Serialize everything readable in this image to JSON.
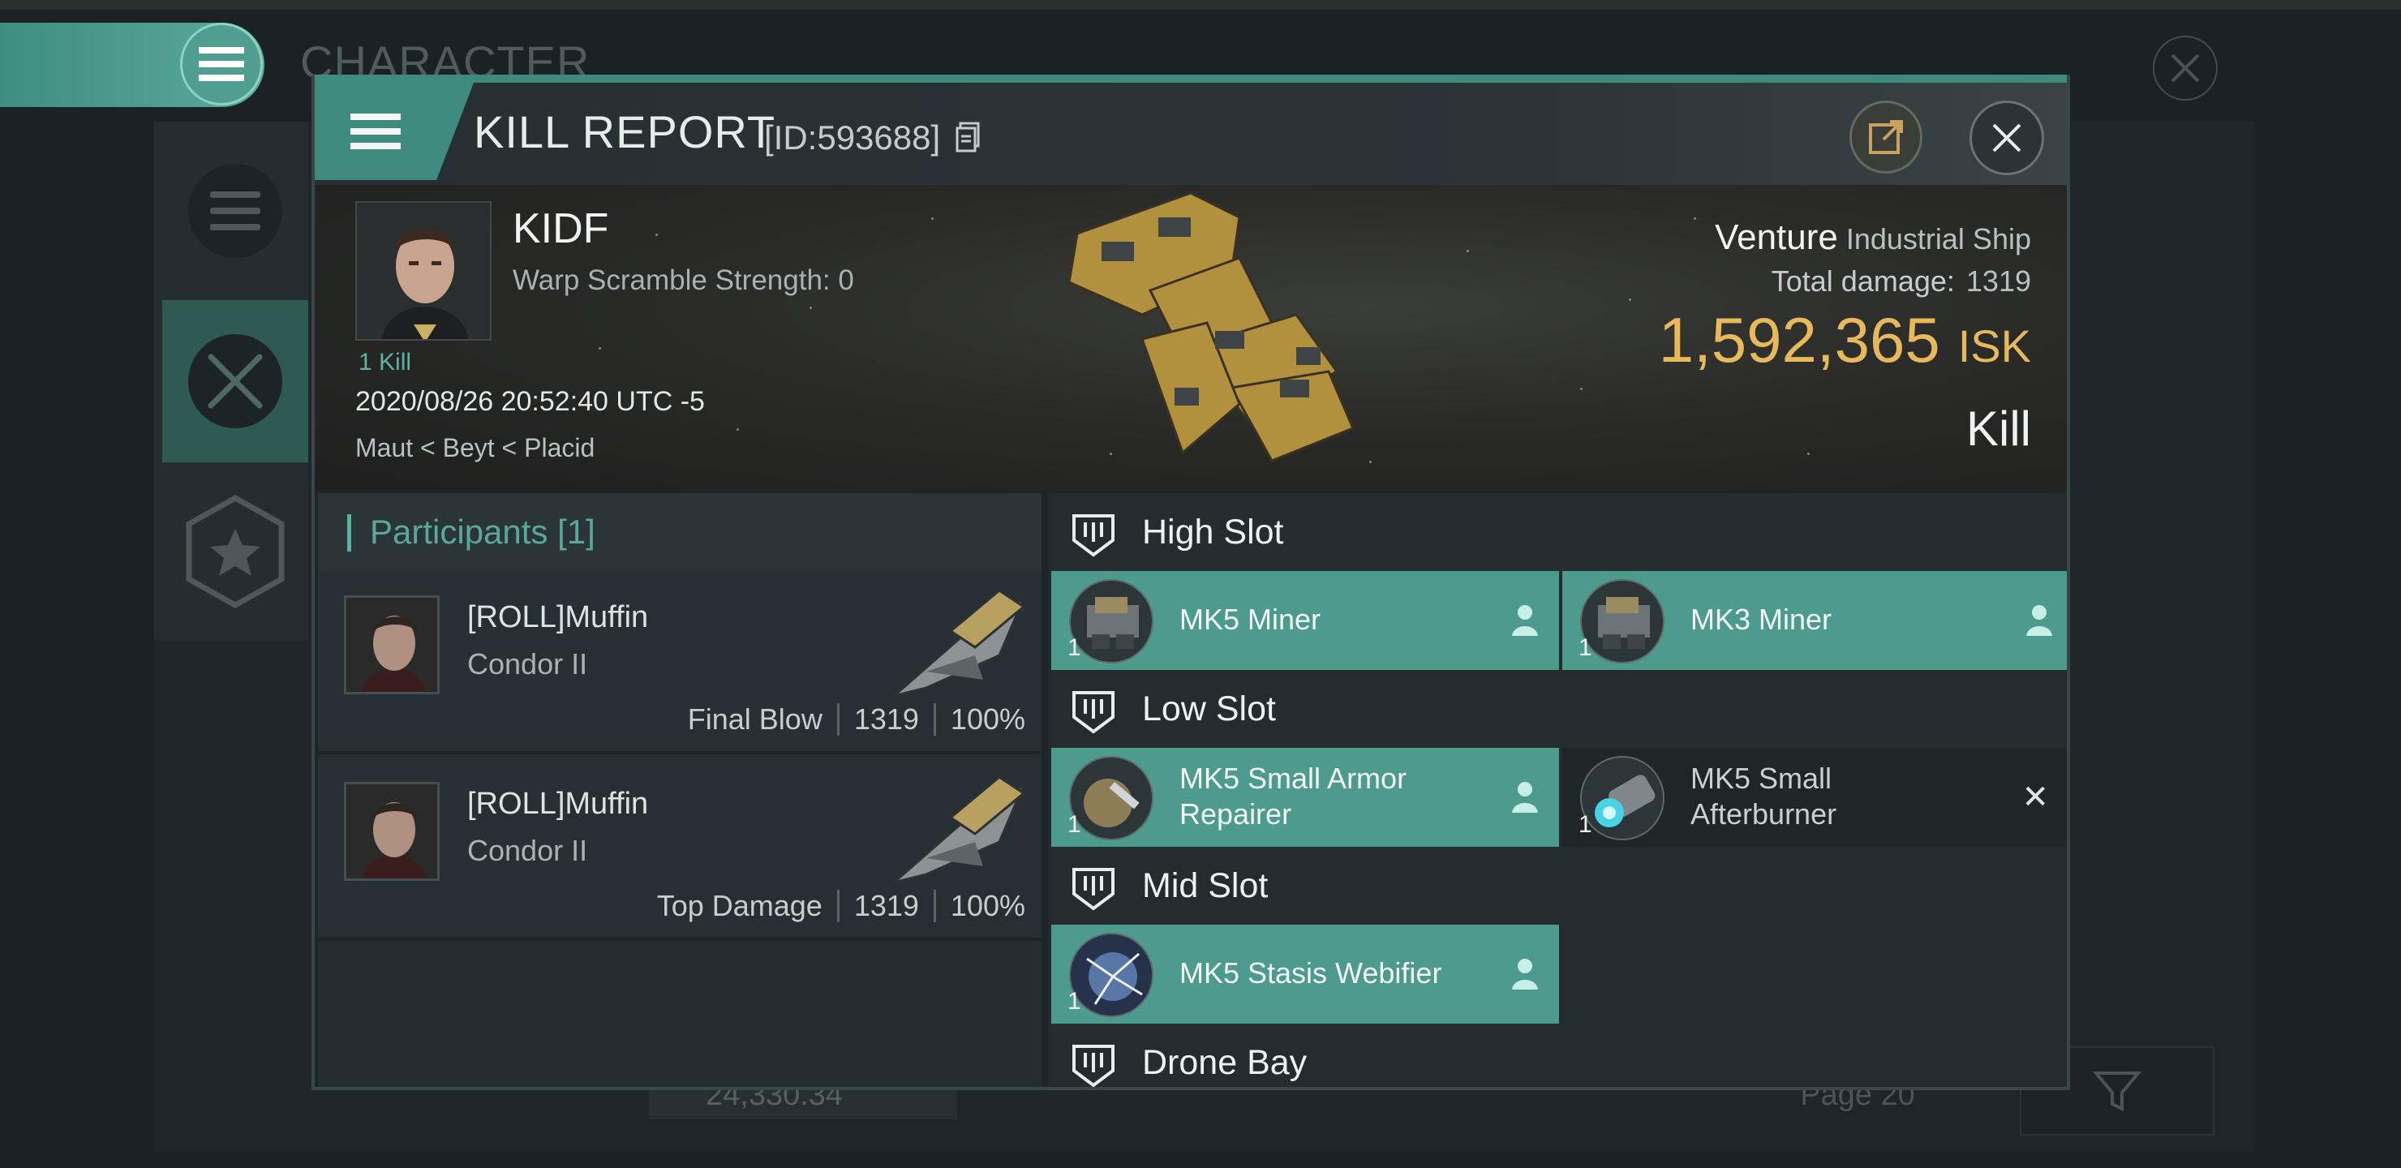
{
  "background": {
    "title": "CHARACTER",
    "bottom_value": "24,330.34",
    "page_label": "Page 20"
  },
  "dialog": {
    "title": "KILL REPORT",
    "report_id": "[ID:593688]"
  },
  "victim": {
    "name": "KIDF",
    "warp_scramble": "Warp Scramble Strength: 0",
    "kills_link": "1 Kill",
    "timestamp": "2020/08/26 20:52:40 UTC -5",
    "location": "Maut < Beyt < Placid"
  },
  "ship": {
    "name": "Venture",
    "class": "Industrial Ship",
    "total_damage_label": "Total damage:",
    "total_damage": "1319",
    "isk_value": "1,592,365",
    "isk_unit": "ISK",
    "result": "Kill"
  },
  "participants": {
    "header": "Participants [1]",
    "rows": [
      {
        "name": "[ROLL]Muffin",
        "ship": "Condor II",
        "role": "Final Blow",
        "damage": "1319",
        "percent": "100%"
      },
      {
        "name": "[ROLL]Muffin",
        "ship": "Condor II",
        "role": "Top Damage",
        "damage": "1319",
        "percent": "100%"
      }
    ]
  },
  "slots": {
    "high": {
      "label": "High Slot",
      "modules": [
        {
          "name": "MK5 Miner",
          "qty": "1",
          "status": "fitted"
        },
        {
          "name": "MK3 Miner",
          "qty": "1",
          "status": "fitted"
        }
      ]
    },
    "low": {
      "label": "Low Slot",
      "modules": [
        {
          "name": "MK5 Small Armor Repairer",
          "name_line1": "MK5 Small Armor",
          "name_line2": "Repairer",
          "qty": "1",
          "status": "fitted"
        },
        {
          "name": "MK5 Small Afterburner",
          "name_line1": "MK5 Small",
          "name_line2": "Afterburner",
          "qty": "1",
          "status": "destroyed"
        }
      ]
    },
    "mid": {
      "label": "Mid Slot",
      "modules": [
        {
          "name": "MK5 Stasis Webifier",
          "qty": "1",
          "status": "fitted"
        }
      ]
    },
    "drone": {
      "label": "Drone Bay"
    }
  },
  "colors": {
    "accent": "#3e8c7e",
    "fitted_module": "#4d9b8d",
    "isk_gold": "#e8b95a",
    "participants_header": "#5aa89b"
  },
  "icons": [
    "menu-icon",
    "copy-icon",
    "share-icon",
    "close-icon",
    "slot-shield-icon",
    "person-icon",
    "x-mark-icon",
    "filter-icon",
    "star-badge-icon",
    "crossed-swords-icon"
  ]
}
